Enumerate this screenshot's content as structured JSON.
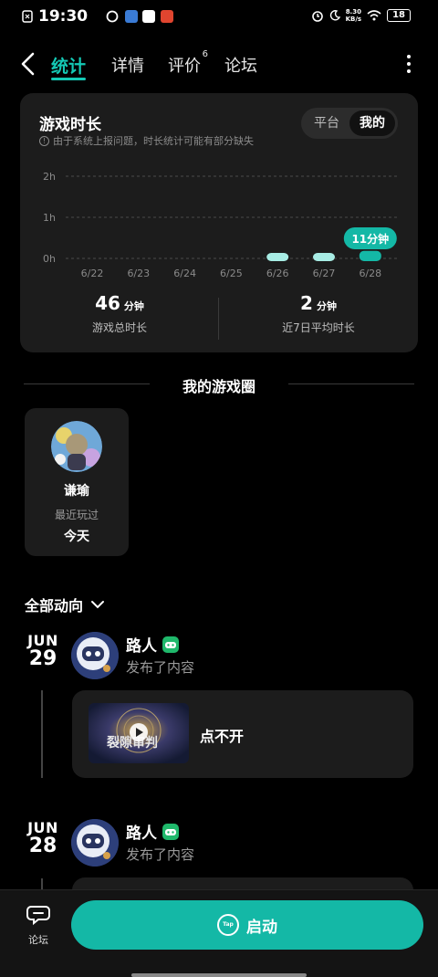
{
  "status_bar": {
    "time": "19:30",
    "net_speed_value": "8.30",
    "net_speed_unit": "KB/s",
    "battery": "18"
  },
  "nav": {
    "tabs": [
      {
        "label": "统计",
        "active": true
      },
      {
        "label": "详情",
        "active": false
      },
      {
        "label": "评价",
        "badge": "6",
        "active": false
      },
      {
        "label": "论坛",
        "active": false
      }
    ]
  },
  "playtime": {
    "title": "游戏时长",
    "note": "由于系统上报问题，时长统计可能有部分缺失",
    "toggle": {
      "options": [
        "平台",
        "我的"
      ],
      "selected": "我的"
    },
    "total_value": "46",
    "total_unit": "分钟",
    "total_label": "游戏总时长",
    "avg_value": "2",
    "avg_unit": "分钟",
    "avg_label": "近7日平均时长"
  },
  "chart_data": {
    "type": "bar",
    "categories": [
      "6/22",
      "6/23",
      "6/24",
      "6/25",
      "6/26",
      "6/27",
      "6/28"
    ],
    "values": [
      0,
      0,
      0,
      0,
      0,
      0,
      11
    ],
    "value_unit": "分钟",
    "y_ticks": [
      "0h",
      "1h",
      "2h"
    ],
    "ylim_hours": [
      0,
      2
    ],
    "highlight_label": "11分钟",
    "grid": true
  },
  "circle_section": {
    "title": "我的游戏圈",
    "card": {
      "name": "谦瑜",
      "sub": "最近玩过",
      "when": "今天"
    }
  },
  "feed": {
    "filter_label": "全部动向",
    "items": [
      {
        "month": "JUN",
        "day": "29",
        "user": "路人",
        "action": "发布了内容",
        "post_title": "点不开",
        "thumb_text": "裂隙审判"
      },
      {
        "month": "JUN",
        "day": "28",
        "user": "路人",
        "action": "发布了内容"
      }
    ]
  },
  "bottom": {
    "forum_label": "论坛",
    "launch_label": "启动",
    "tap_logo": "Tap"
  },
  "colors": {
    "accent": "#14c9b5",
    "launch": "#14b8a6",
    "card": "#1c1c1c",
    "badge": "#1fb86b"
  }
}
